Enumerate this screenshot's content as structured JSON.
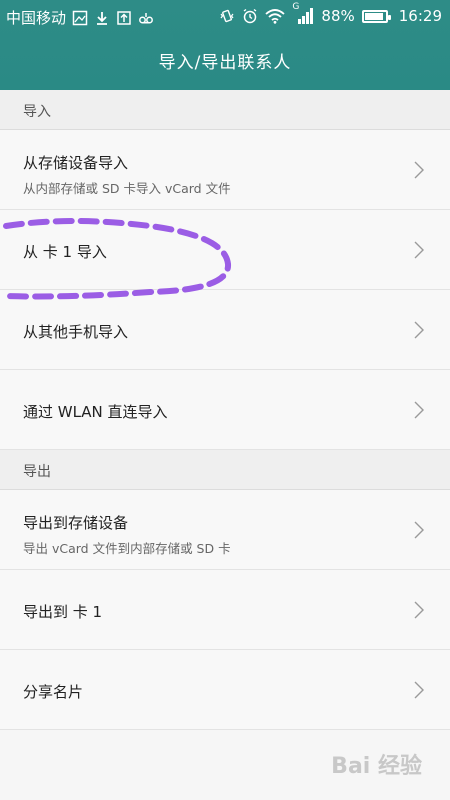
{
  "status_bar": {
    "carrier": "中国移动",
    "battery_percent": "88%",
    "battery_level": 0.88,
    "time": "16:29",
    "network_label": "G",
    "icons": [
      "gallery-icon",
      "download-icon",
      "upload-icon",
      "voicemail-icon",
      "vibrate-icon",
      "alarm-icon",
      "wifi-icon",
      "signal-icon",
      "battery-icon"
    ]
  },
  "header": {
    "title": "导入/导出联系人"
  },
  "sections": [
    {
      "label": "导入",
      "items": [
        {
          "title": "从存储设备导入",
          "subtitle": "从内部存储或 SD 卡导入 vCard 文件"
        },
        {
          "title": "从 卡 1 导入",
          "subtitle": ""
        },
        {
          "title": "从其他手机导入",
          "subtitle": ""
        },
        {
          "title": "通过 WLAN 直连导入",
          "subtitle": ""
        }
      ]
    },
    {
      "label": "导出",
      "items": [
        {
          "title": "导出到存储设备",
          "subtitle": "导出 vCard 文件到内部存储或 SD 卡"
        },
        {
          "title": "导出到 卡 1",
          "subtitle": ""
        },
        {
          "title": "分享名片",
          "subtitle": ""
        }
      ]
    }
  ],
  "watermark": {
    "text": "Bai 经验"
  },
  "colors": {
    "header": "#2e8c87",
    "annotation": "#9b5de5"
  }
}
